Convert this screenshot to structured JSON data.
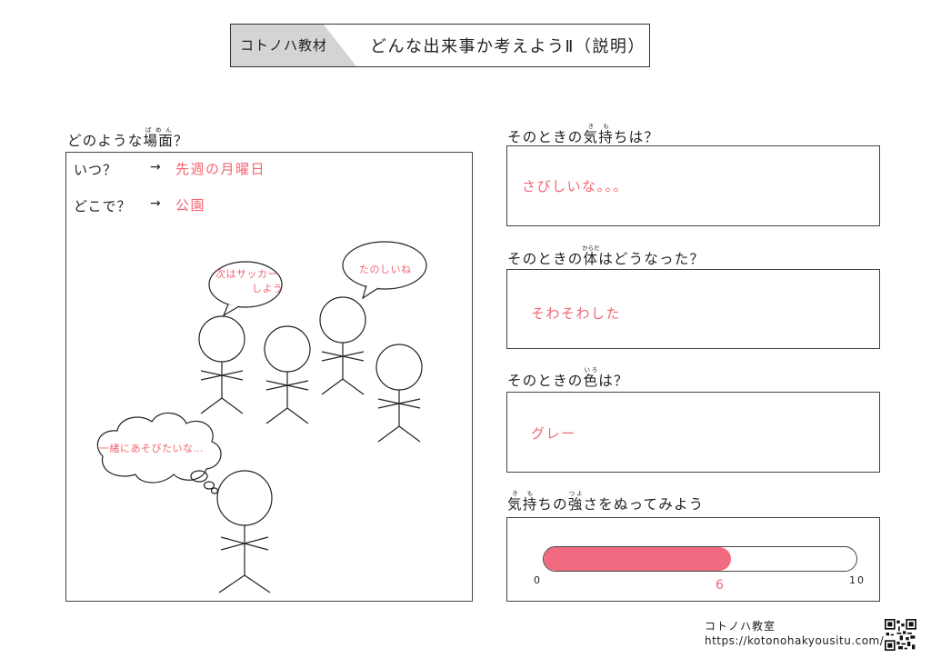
{
  "header": {
    "brand": "コトノハ教材",
    "title": "どんな出来事か考えようⅡ（説明）"
  },
  "scene": {
    "label_base": "どのような",
    "label_ruby_base": "場面",
    "label_ruby": "ばめん",
    "label_end": "？",
    "when_label": "いつ？",
    "when_arrow": "→",
    "when_value": "先週の月曜日",
    "where_label": "どこで？",
    "where_arrow": "→",
    "where_value": "公園",
    "bubble_1_line1": "次はサッカー",
    "bubble_1_line2": "しよう",
    "bubble_2": "たのしいね",
    "thought": "一緒にあそびたいな…"
  },
  "feeling": {
    "label_start": "そのときの",
    "k1": "気",
    "r1": "き",
    "k2": "持",
    "r2": "も",
    "label_end": "ちは？",
    "answer": "さびしいな。。。"
  },
  "body": {
    "label_start": "そのときの",
    "k1": "体",
    "r1": "からだ",
    "label_end": "はどうなった？",
    "answer": "そわそわした"
  },
  "color": {
    "label_start": "そのときの",
    "k1": "色",
    "r1": "いろ",
    "label_end": "は？",
    "answer": "グレー"
  },
  "strength": {
    "k1": "気",
    "r1": "き",
    "k2": "持",
    "r2": "も",
    "mid": "ちの",
    "k3": "強",
    "r3": "つよ",
    "label_end": "さをぬってみよう",
    "min_label": "0",
    "max_label": "10",
    "value_label": "6",
    "value": 6,
    "max": 10,
    "fill_color": "#f26a80"
  },
  "footer": {
    "name": "コトノハ教室",
    "url": "https://kotonohakyousitu.com/"
  }
}
